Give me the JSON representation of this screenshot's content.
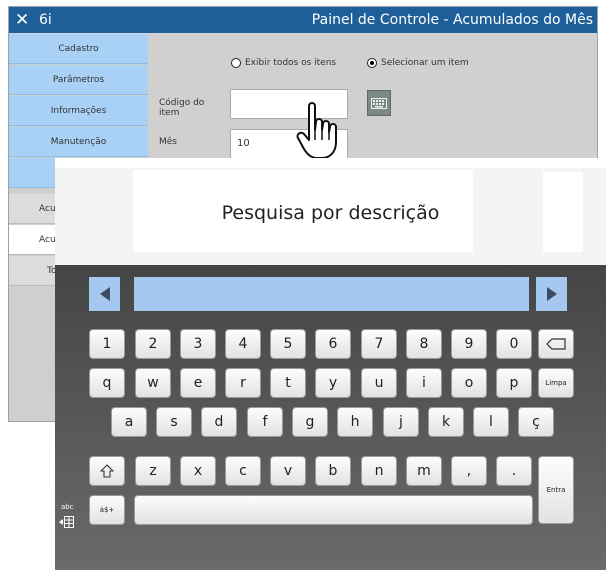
{
  "window": {
    "close_glyph": "✕",
    "app_name": "6i",
    "title": "Painel de Controle - Acumulados do Mês"
  },
  "sidebar": {
    "items": [
      {
        "label": "Cadastro"
      },
      {
        "label": "Parâmetros"
      },
      {
        "label": "Informações"
      },
      {
        "label": "Manutenção"
      },
      {
        "label": ""
      },
      {
        "label": "Acu"
      },
      {
        "label": "Acu"
      },
      {
        "label": "To"
      }
    ]
  },
  "content": {
    "radio_all": "Exibir todos os itens",
    "radio_one": "Selecionar um item",
    "selected_radio": "radio_one",
    "codigo_label": "Código do item",
    "codigo_value": "",
    "mes_label": "Mês",
    "mes_value": "10"
  },
  "keyboard": {
    "title": "Pesquisa por descrição",
    "search_value": "",
    "row1": [
      "1",
      "2",
      "3",
      "4",
      "5",
      "6",
      "7",
      "8",
      "9",
      "0"
    ],
    "row2": [
      "q",
      "w",
      "e",
      "r",
      "t",
      "y",
      "u",
      "i",
      "o",
      "p"
    ],
    "row3": [
      "a",
      "s",
      "d",
      "f",
      "g",
      "h",
      "j",
      "k",
      "l",
      "ç"
    ],
    "row4": [
      "z",
      "x",
      "c",
      "v",
      "b",
      "n",
      "m",
      ",",
      "."
    ],
    "clear_label": "Limpa",
    "enter_label": "Entra",
    "symbols_label": "á$+",
    "abc_label": "abc"
  },
  "colors": {
    "titlebar": "#1f5f99",
    "sidebar_active": "#a8d1f5",
    "key_bar": "#a4c8ef"
  },
  "icons": [
    "close-icon",
    "keyboard-icon",
    "hand-cursor-icon",
    "left-arrow-icon",
    "right-arrow-icon",
    "backspace-icon",
    "shift-icon",
    "layout-switch-icon"
  ]
}
